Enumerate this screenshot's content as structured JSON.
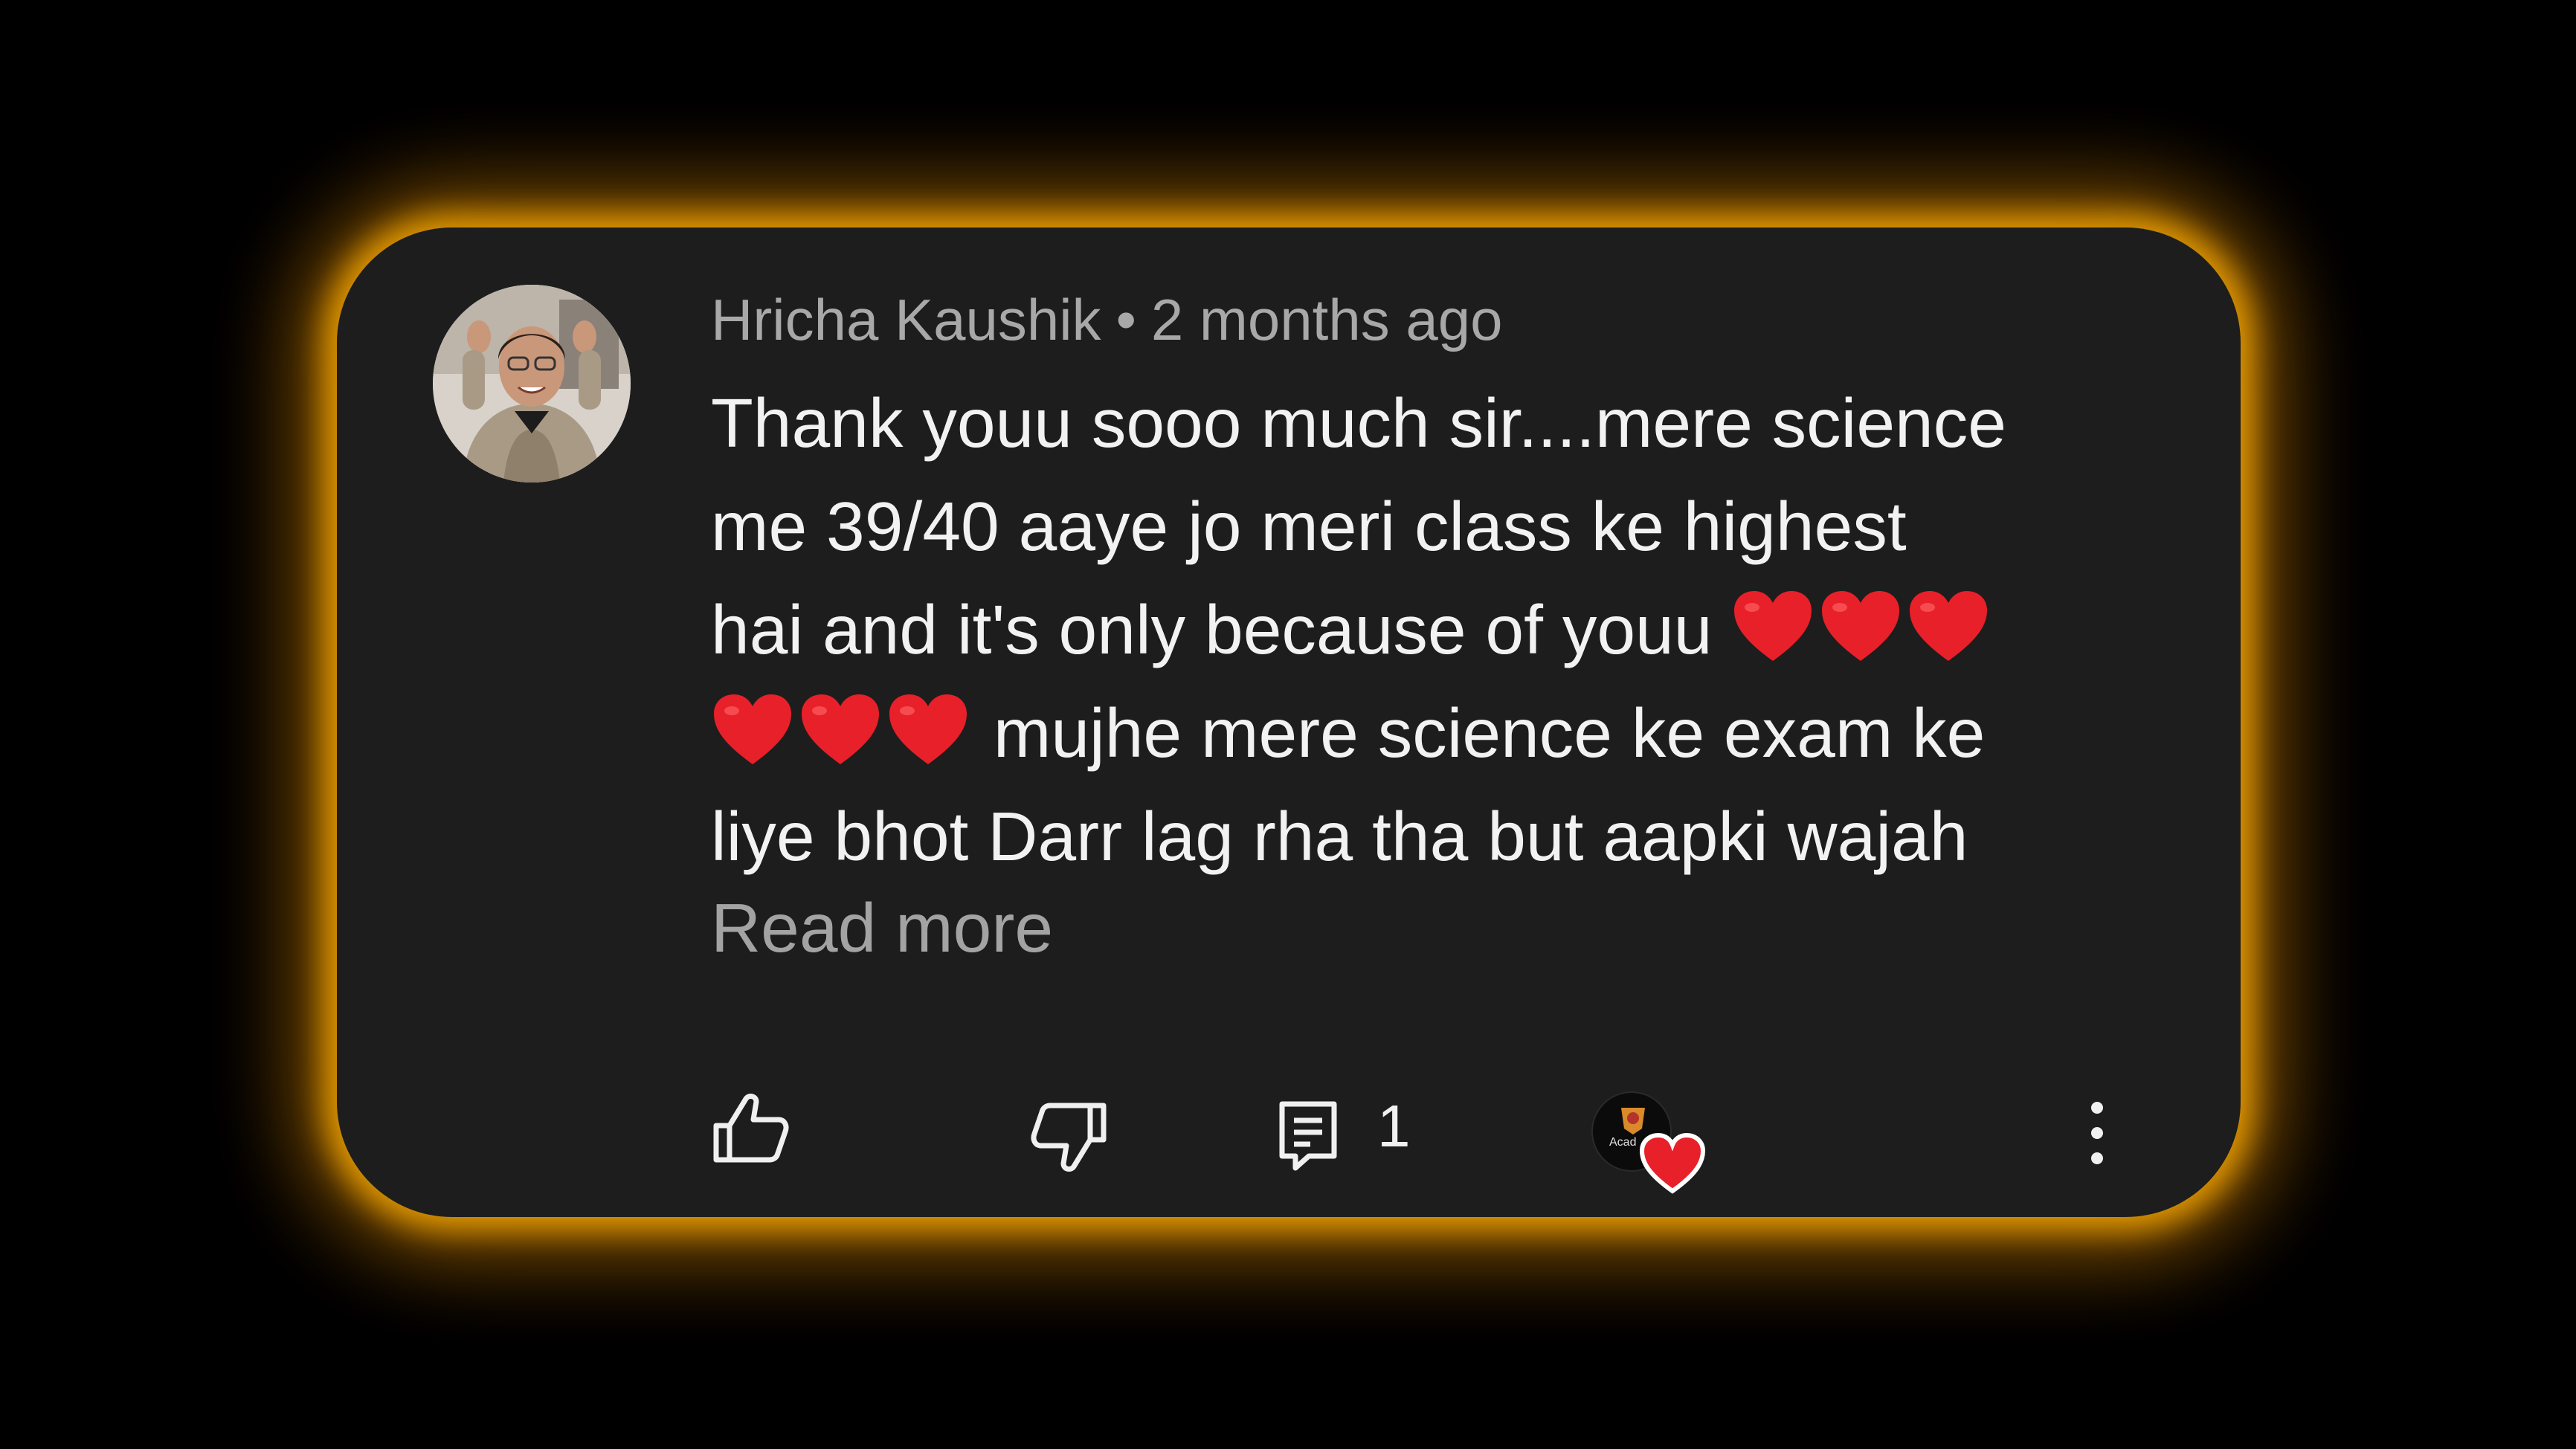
{
  "comment": {
    "author": "Hricha Kaushik",
    "separator": "•",
    "timestamp": "2 months ago",
    "lines": [
      "Thank youu sooo much sir....mere science",
      "me 39/40 aaye jo meri class ke highest",
      "hai and it's only because of youu",
      "mujhe mere science ke exam ke",
      "liye bhot Darr lag rha tha but aapki wajah"
    ],
    "read_more_label": "Read more"
  },
  "actions": {
    "reply_count": "1",
    "creator_avatar_text": "Acad"
  },
  "colors": {
    "card_background": "#1d1d1d",
    "glow": "#e69b00",
    "heart": "#e8202a",
    "author_text": "#a8a8a8",
    "body_text": "#f2f2f2"
  },
  "icons": [
    "like-icon",
    "dislike-icon",
    "reply-icon",
    "heart-icon",
    "more-vertical-icon"
  ]
}
